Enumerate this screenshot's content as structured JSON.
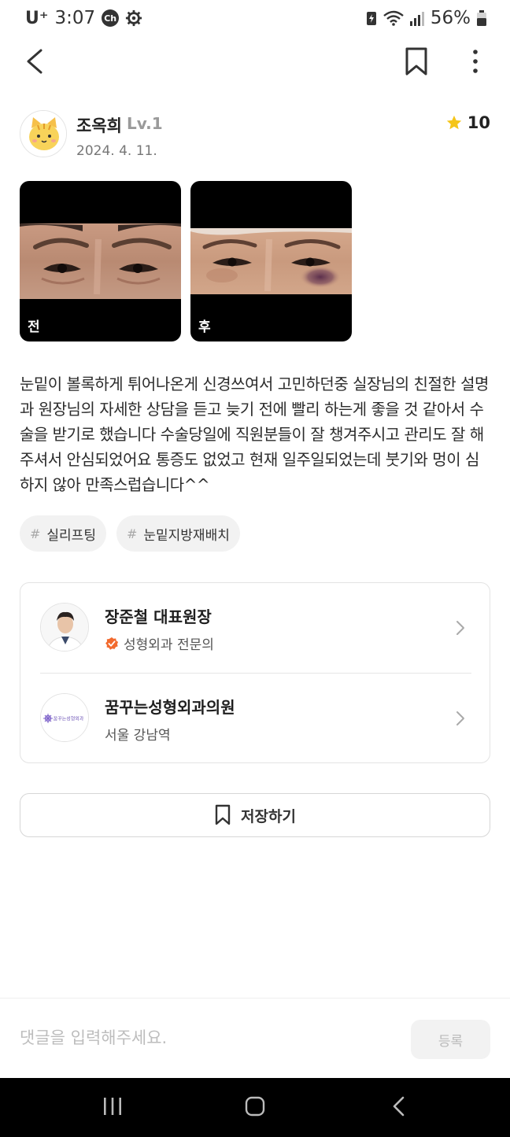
{
  "status_bar": {
    "carrier": "U⁺",
    "time": "3:07",
    "notification_badge": "Ch",
    "battery": "56%"
  },
  "author": {
    "name": "조옥희",
    "level": "Lv.1",
    "date": "2024. 4. 11.",
    "rating": "10"
  },
  "photos": [
    {
      "label": "전"
    },
    {
      "label": "후"
    }
  ],
  "review": {
    "text": "눈밑이 볼록하게 튀어나온게 신경쓰여서 고민하던중 실장님의 친절한 설명과 원장님의 자세한 상담을 듣고 늦기 전에 빨리 하는게 좋을 것 같아서 수술을 받기로 했습니다 수술당일에 직원분들이 잘 챙겨주시고 관리도 잘 해주셔서 안심되었어요 통증도 없었고 현재 일주일되었는데 붓기와 멍이 심하지 않아 만족스럽습니다^^"
  },
  "tags": [
    {
      "hash": "#",
      "label": "실리프팅"
    },
    {
      "hash": "#",
      "label": "눈밑지방재배치"
    }
  ],
  "doctor": {
    "name": "장준철 대표원장",
    "specialty": "성형외과 전문의"
  },
  "clinic": {
    "name": "꿈꾸는성형외과의원",
    "location": "서울 강남역",
    "logo_text": "꿈꾸는성형외과"
  },
  "save_button": {
    "label": "저장하기"
  },
  "comment": {
    "placeholder": "댓글을 입력해주세요.",
    "submit_label": "등록"
  },
  "colors": {
    "star": "#f5c518",
    "verified_badge": "#f26a2e",
    "bruise": "#6b3b58"
  }
}
